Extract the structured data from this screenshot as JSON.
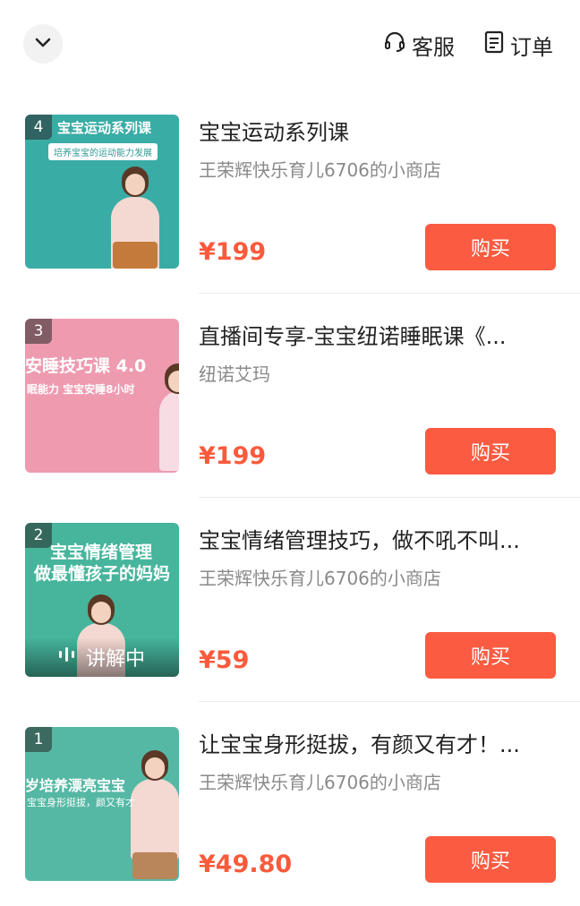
{
  "header": {
    "service_label": "客服",
    "orders_label": "订单"
  },
  "colors": {
    "accent": "#fa5b41",
    "price": "#fa5a3c"
  },
  "products": [
    {
      "rank": "4",
      "title": "宝宝运动系列课",
      "shop": "王荣辉快乐育儿6706的小商店",
      "price": "¥199",
      "buy_label": "购买",
      "thumb_headline": "宝宝运动系列课",
      "thumb_sub": "培养宝宝的运动能力发展",
      "thumb_color": "#3aaca6"
    },
    {
      "rank": "3",
      "title": "直播间专享-宝宝纽诺睡眠课《...",
      "shop": "纽诺艾玛",
      "price": "¥199",
      "buy_label": "购买",
      "thumb_headline": "安睡技巧课 4.0",
      "thumb_sub": "眠能力 宝宝安睡8小时",
      "thumb_color": "#ee9bb0"
    },
    {
      "rank": "2",
      "title": "宝宝情绪管理技巧，做不吼不叫...",
      "shop": "王荣辉快乐育儿6706的小商店",
      "price": "¥59",
      "buy_label": "购买",
      "thumb_headline": "宝宝情绪管理",
      "thumb_sub": "做最懂孩子的妈妈",
      "thumb_color": "#46b59c",
      "live_label": "讲解中"
    },
    {
      "rank": "1",
      "title": "让宝宝身形挺拔，有颜又有才！...",
      "shop": "王荣辉快乐育儿6706的小商店",
      "price": "¥49.80",
      "buy_label": "购买",
      "thumb_headline": "岁培养漂亮宝宝",
      "thumb_sub": "宝宝身形挺拔，颜又有才",
      "thumb_color": "#55b8a4"
    }
  ]
}
